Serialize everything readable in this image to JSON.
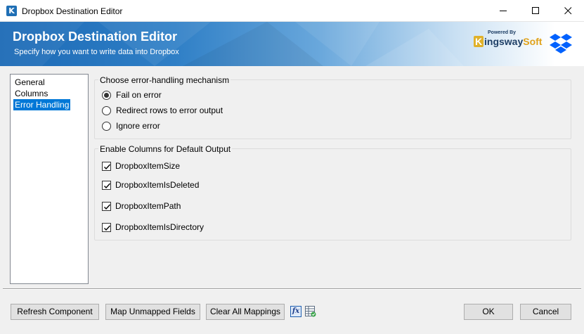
{
  "window": {
    "title": "Dropbox Destination Editor",
    "icon_letter": "K"
  },
  "banner": {
    "title": "Dropbox Destination Editor",
    "subtitle": "Specify how you want to write data into Dropbox",
    "logo_powered": "Powered By",
    "logo_letter": "K",
    "logo_part1": "ingsway",
    "logo_part2": "Soft",
    "logo_color_a": "#1e3f66",
    "logo_color_b": "#e0a21a",
    "dropbox_icon": "dropbox-icon"
  },
  "nav": {
    "items": [
      {
        "label": "General",
        "selected": false
      },
      {
        "label": "Columns",
        "selected": false
      },
      {
        "label": "Error Handling",
        "selected": true
      }
    ]
  },
  "error_handling": {
    "group_label": "Choose error-handling mechanism",
    "options": [
      {
        "label": "Fail on error",
        "checked": true
      },
      {
        "label": "Redirect rows to error output",
        "checked": false
      },
      {
        "label": "Ignore error",
        "checked": false
      }
    ]
  },
  "default_output": {
    "group_label": "Enable Columns for Default Output",
    "columns": [
      {
        "label": "DropboxItemSize",
        "checked": true
      },
      {
        "label": "DropboxItemIsDeleted",
        "checked": true
      },
      {
        "label": "DropboxItemPath",
        "checked": true
      },
      {
        "label": "DropboxItemIsDirectory",
        "checked": true
      }
    ]
  },
  "footer": {
    "refresh_label": "Refresh Component",
    "map_label": "Map Unmapped Fields",
    "clear_label": "Clear All Mappings",
    "fx_label": "fx",
    "ok_label": "OK",
    "cancel_label": "Cancel"
  },
  "colors": {
    "accent": "#0078d7",
    "banner_blue": "#1c6ab6"
  }
}
